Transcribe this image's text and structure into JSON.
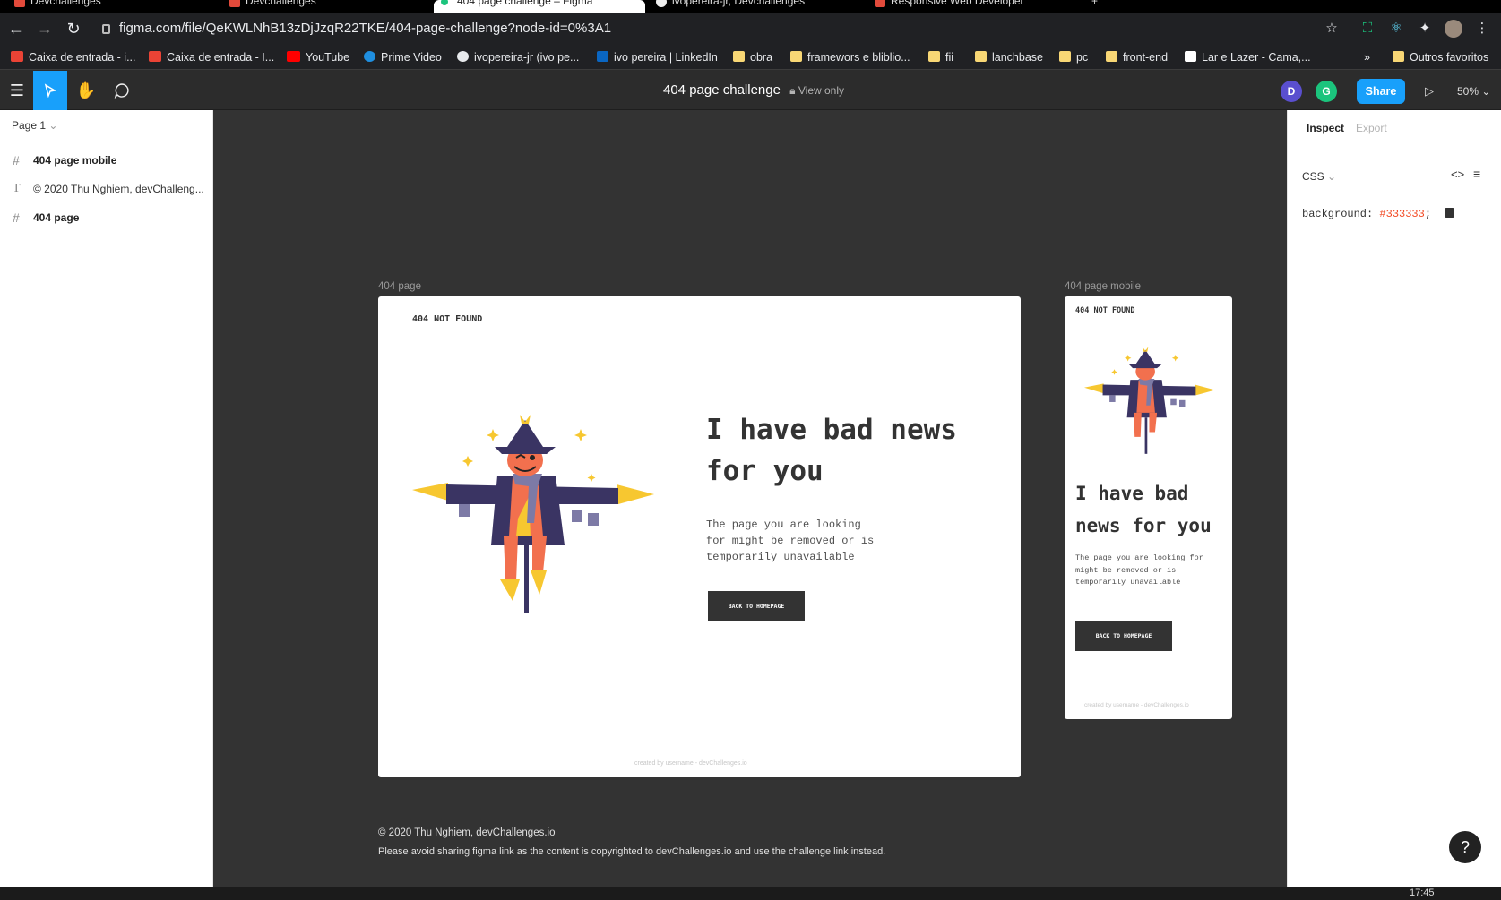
{
  "tabs": [
    {
      "label": "Devchallenges",
      "active": false
    },
    {
      "label": "Devchallenges",
      "active": false
    },
    {
      "label": "404 page challenge – Figma",
      "active": true
    },
    {
      "label": "ivopereira-jr, Devchallenges",
      "active": false
    },
    {
      "label": "Responsive Web Developer",
      "active": false
    }
  ],
  "browser": {
    "url": "figma.com/file/QeKWLNhB13zDjJzqR22TKE/404-page-challenge?node-id=0%3A1"
  },
  "bookmarks": [
    {
      "label": "Caixa de entrada - i...",
      "icon": "gmail-icon"
    },
    {
      "label": "Caixa de entrada - I...",
      "icon": "gmail-icon"
    },
    {
      "label": "YouTube",
      "icon": "youtube-icon"
    },
    {
      "label": "Prime Video",
      "icon": "prime-video-icon"
    },
    {
      "label": "ivopereira-jr (ivo pe...",
      "icon": "github-icon"
    },
    {
      "label": "ivo pereira | LinkedIn",
      "icon": "linkedin-icon"
    },
    {
      "label": "obra",
      "icon": "folder-icon"
    },
    {
      "label": "framewors e bliblio...",
      "icon": "folder-icon"
    },
    {
      "label": "fii",
      "icon": "folder-icon"
    },
    {
      "label": "lanchbase",
      "icon": "folder-icon"
    },
    {
      "label": "pc",
      "icon": "folder-icon"
    },
    {
      "label": "front-end",
      "icon": "folder-icon"
    },
    {
      "label": "Lar e Lazer - Cama,...",
      "icon": "site-icon"
    },
    {
      "label": "»",
      "icon": ""
    },
    {
      "label": "Outros favoritos",
      "icon": "folder-icon"
    }
  ],
  "figma": {
    "file_title": "404 page challenge",
    "view_only": "View only",
    "avatars": [
      "D",
      "G"
    ],
    "share": "Share",
    "zoom": "50%"
  },
  "left_panel": {
    "page": "Page 1",
    "layers": [
      {
        "label": "404 page mobile",
        "type": "frame"
      },
      {
        "label": "© 2020 Thu Nghiem, devChalleng...",
        "type": "text"
      },
      {
        "label": "404 page",
        "type": "frame"
      }
    ]
  },
  "canvas": {
    "desktop": {
      "frame_label": "404 page",
      "logo": "404 NOT FOUND",
      "headline_line1": "I have bad news",
      "headline_line2": "for you",
      "para_line1": "The page you are looking",
      "para_line2": "for might be removed or is",
      "para_line3": "temporarily unavailable",
      "button": "BACK TO HOMEPAGE",
      "credit": "created by username - devChallenges.io"
    },
    "mobile": {
      "frame_label": "404 page mobile",
      "logo": "404 NOT FOUND",
      "headline_line1": "I have bad",
      "headline_line2": "news for you",
      "para_line1": "The page you are looking for",
      "para_line2": "might be removed or is",
      "para_line3": "temporarily unavailable",
      "button": "BACK TO HOMEPAGE",
      "credit": "created by username - devChallenges.io"
    },
    "copyright": "© 2020 Thu Nghiem, devChallenges.io",
    "notice": "Please avoid sharing figma link as the content is copyrighted to devChallenges.io and use the challenge link instead."
  },
  "right_panel": {
    "tab_inspect": "Inspect",
    "tab_export": "Export",
    "code_lang": "CSS",
    "css_property": "background:",
    "css_value": "#333333",
    "css_semicolon": ";"
  },
  "taskbar": {
    "clock": "17:45"
  },
  "colors": {
    "accent": "#18a0fb",
    "canvas": "#333333",
    "scarecrow_body": "#3a3463",
    "scarecrow_orange": "#f2704e",
    "straw": "#f7c730"
  }
}
